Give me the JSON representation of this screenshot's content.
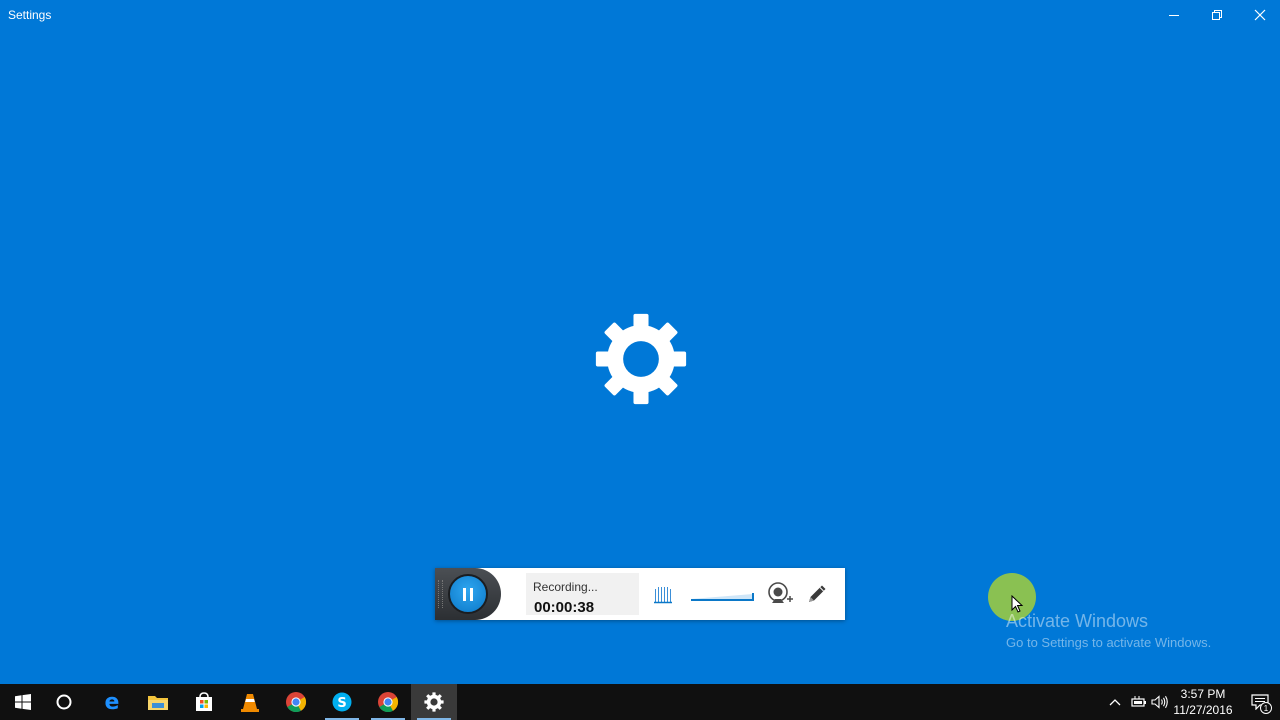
{
  "window": {
    "title": "Settings"
  },
  "recorder": {
    "status": "Recording...",
    "elapsed": "00:00:38"
  },
  "watermark": {
    "title": "Activate Windows",
    "subtitle": "Go to Settings to activate Windows."
  },
  "taskbar": {
    "pinned": [
      {
        "name": "start-button",
        "icon": "windows-logo-icon"
      },
      {
        "name": "cortana-button",
        "icon": "circle-icon"
      },
      {
        "name": "edge",
        "icon": "edge-icon"
      },
      {
        "name": "file-explorer",
        "icon": "folder-icon"
      },
      {
        "name": "store",
        "icon": "store-bag-icon"
      },
      {
        "name": "vlc",
        "icon": "traffic-cone-icon"
      },
      {
        "name": "chrome",
        "icon": "chrome-icon"
      },
      {
        "name": "skype",
        "icon": "skype-icon"
      },
      {
        "name": "chrome-2",
        "icon": "chrome-icon"
      },
      {
        "name": "settings",
        "icon": "gear-icon"
      }
    ],
    "clock_time": "3:57 PM",
    "clock_date": "11/27/2016",
    "notifications_count": "1"
  },
  "colors": {
    "desktop_blue": "#0078d7",
    "taskbar": "#101010",
    "accent": "#0b78c8",
    "cursor_highlight": "#96c846"
  }
}
